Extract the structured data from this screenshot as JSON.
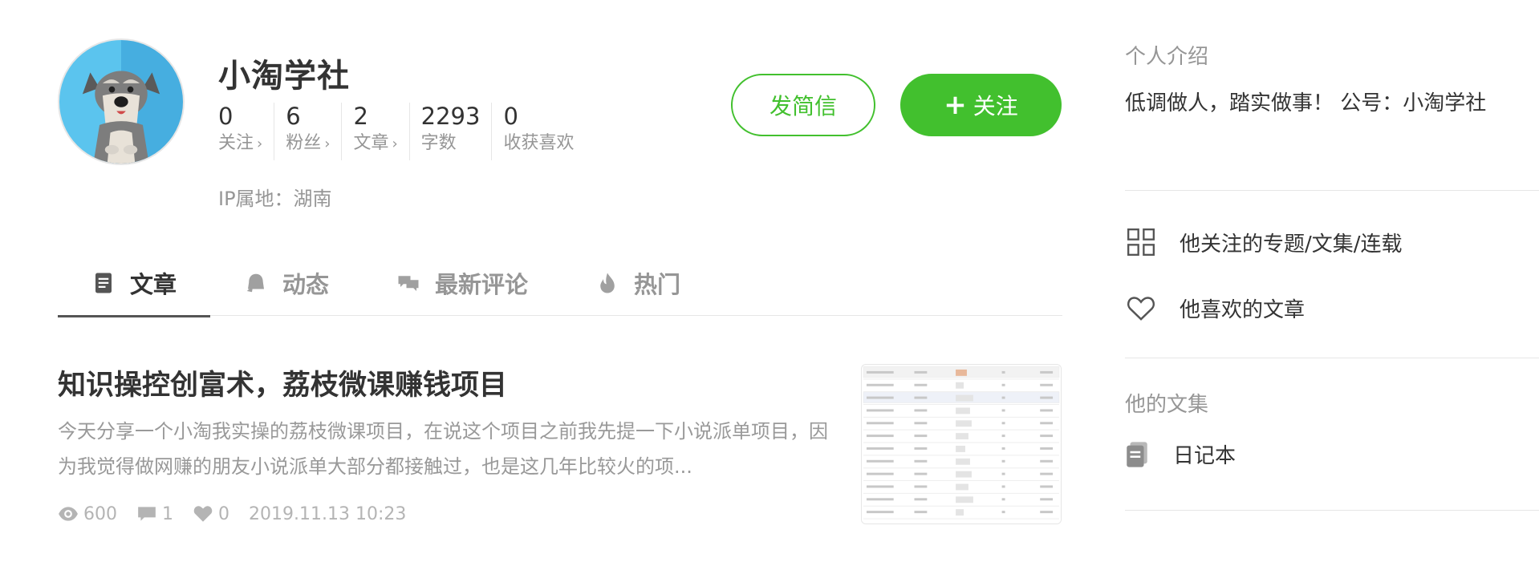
{
  "profile": {
    "username": "小淘学社",
    "ip_location": "IP属地：湖南",
    "stats": [
      {
        "value": "0",
        "label": "关注",
        "chevron": "›"
      },
      {
        "value": "6",
        "label": "粉丝",
        "chevron": "›"
      },
      {
        "value": "2",
        "label": "文章",
        "chevron": "›"
      },
      {
        "value": "2293",
        "label": "字数",
        "chevron": ""
      },
      {
        "value": "0",
        "label": "收获喜欢",
        "chevron": ""
      }
    ],
    "message_button": "发简信",
    "follow_button": "关注",
    "follow_plus": "+"
  },
  "tabs": [
    {
      "label": "文章",
      "icon": "document-icon"
    },
    {
      "label": "动态",
      "icon": "bell-icon"
    },
    {
      "label": "最新评论",
      "icon": "comments-icon"
    },
    {
      "label": "热门",
      "icon": "flame-icon"
    }
  ],
  "article": {
    "title": "知识操控创富术，荔枝微课赚钱项目",
    "abstract": "今天分享一个小淘我实操的荔枝微课项目，在说这个项目之前我先提一下小说派单项目，因为我觉得做网赚的朋友小说派单大部分都接触过，也是这几年比较火的项...",
    "views": "600",
    "comments": "1",
    "likes": "0",
    "date": "2019.11.13 10:23"
  },
  "sidebar": {
    "intro_title": "个人介绍",
    "intro_text": "低调做人，踏实做事！ 公号：小淘学社",
    "links": [
      {
        "label": "他关注的专题/文集/连载",
        "icon": "grid-icon"
      },
      {
        "label": "他喜欢的文章",
        "icon": "heart-icon"
      }
    ],
    "collections_title": "他的文集",
    "collections": [
      {
        "label": "日记本",
        "icon": "notebook-icon"
      }
    ]
  },
  "colors": {
    "accent_green": "#42c02e",
    "text_dark": "#333333",
    "text_muted": "#969696",
    "divider": "#e6e6e6"
  }
}
